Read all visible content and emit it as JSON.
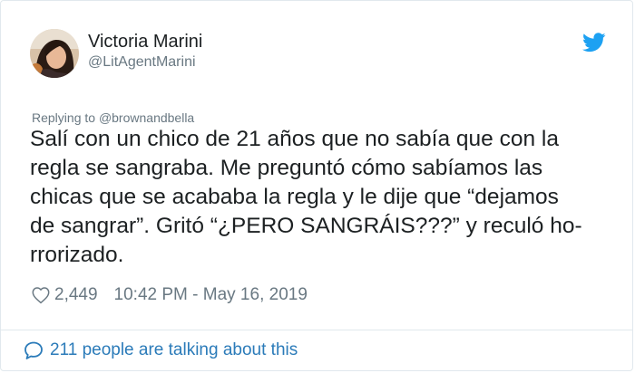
{
  "tweet": {
    "author": {
      "display_name": "Victoria Marini",
      "handle": "@LitAgentMarini",
      "avatar_icon": "profile-photo"
    },
    "brand_icon": "twitter-bird-icon",
    "reply_context": {
      "prefix": "Replying to",
      "mention": "@brownandbella"
    },
    "text_lines": [
      "Salí con un chico de 21 años que no sabía que con la",
      "regla se sangraba. Me preguntó cómo sabíamos las",
      "chicas que se acababa la regla y le dije que “dejamos",
      "de sangrar”. Gritó “¿PERO SANGRÁIS???” y reculó ho-",
      "rrorizado."
    ],
    "likes": "2,449",
    "timestamp": "10:42 PM - May 16, 2019",
    "conversation_link": "211 people are talking about this"
  },
  "colors": {
    "text": "#1c2022",
    "secondary": "#697882",
    "link": "#2b7bb9",
    "twitter_blue": "#1da1f2",
    "divider": "#e1e8ed"
  }
}
